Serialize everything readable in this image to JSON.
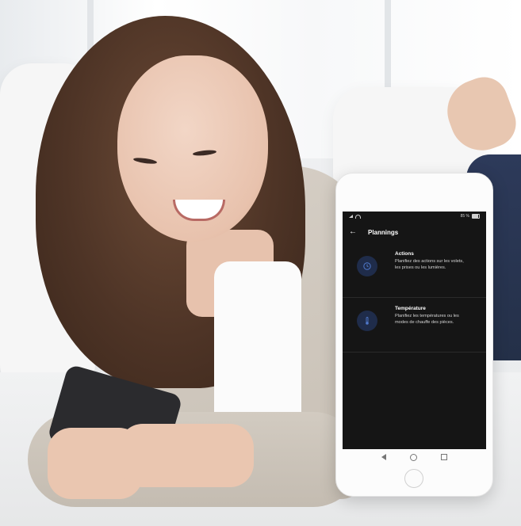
{
  "phone": {
    "status": {
      "battery": "85 %"
    },
    "app_bar": {
      "title": "Plannings",
      "back_icon": "arrow-left-icon"
    },
    "items": [
      {
        "title": "Actions",
        "description": "Planifiez des actions sur les volets, les prises ou les lumières.",
        "icon": "clock-icon"
      },
      {
        "title": "Température",
        "description": "Planifiez les températures ou les modes de chauffe des pièces.",
        "icon": "thermometer-icon"
      }
    ],
    "colors": {
      "screen_bg": "#151515",
      "icon_circle": "#1f2c4a",
      "icon_accent": "#4f78c9"
    }
  }
}
